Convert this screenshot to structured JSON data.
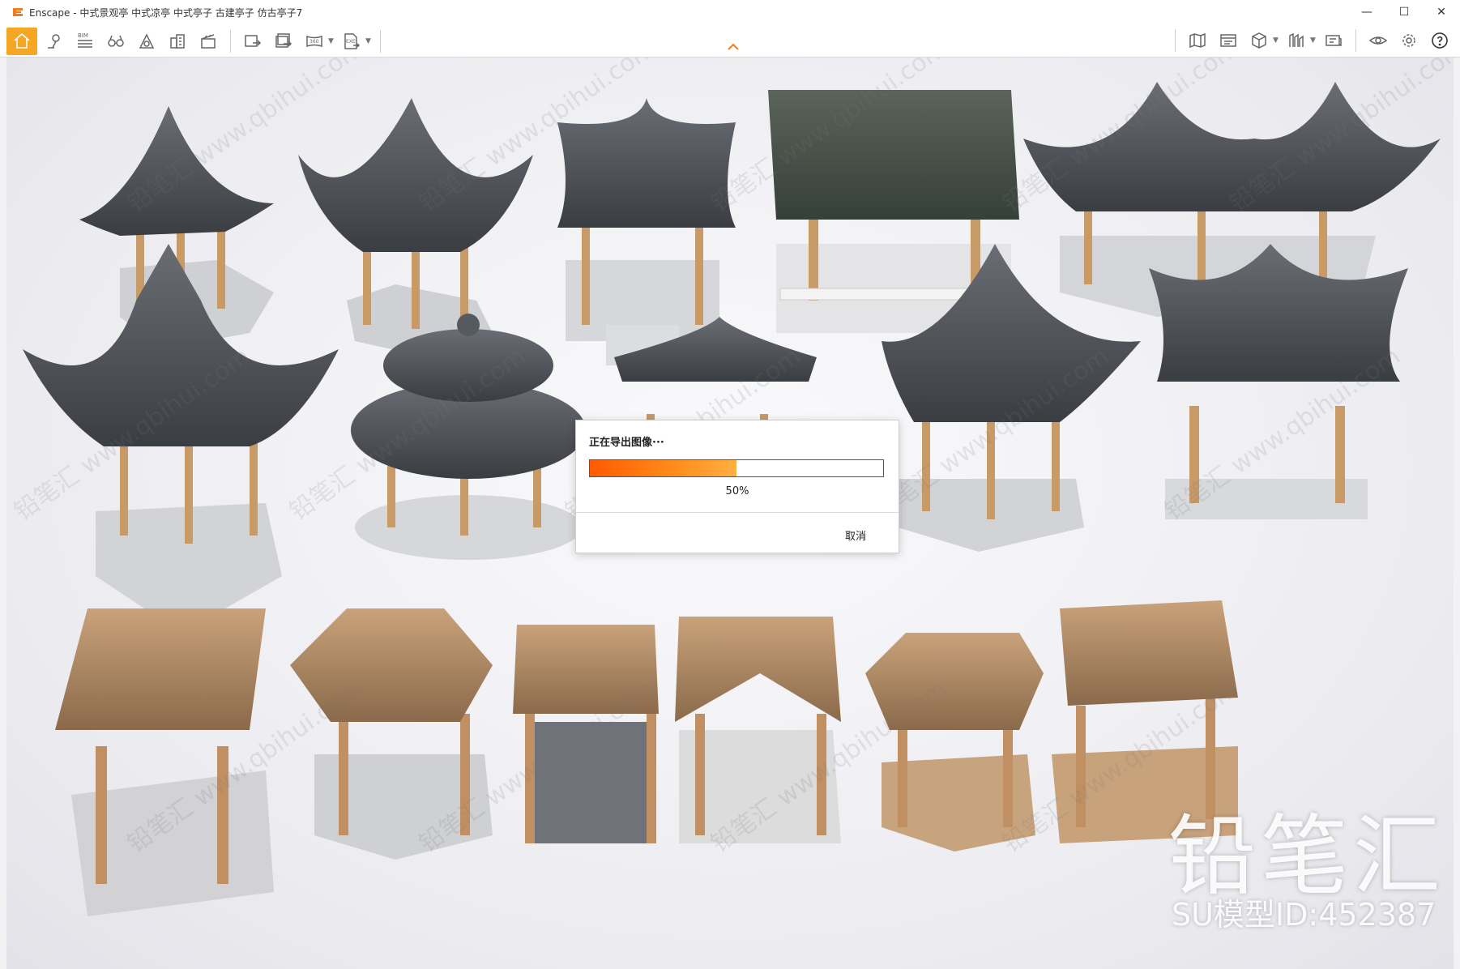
{
  "window": {
    "title": "Enscape - 中式景观亭 中式凉亭 中式亭子 古建亭子 仿古亭子7",
    "accent": "#f5a623",
    "controls": {
      "minimize": "—",
      "maximize": "☐",
      "close": "✕"
    }
  },
  "toolbar": {
    "left_groups": [
      [
        "home-icon",
        "map-pin-icon",
        "bim-icon",
        "binoculars-icon",
        "atmosphere-icon",
        "building-icon",
        "clapper-icon"
      ],
      [
        "screenshot-icon",
        "batch-render-icon",
        "panorama-360-icon",
        "export-exe-icon"
      ]
    ],
    "right_groups": [
      [
        "map-icon",
        "view-icon",
        "cube-icon",
        "asset-library-icon",
        "collaborate-icon"
      ],
      [
        "eye-icon",
        "settings-gear-icon",
        "help-icon"
      ]
    ],
    "bim_label": "BIM",
    "pano_label": "360",
    "exe_label": "EXE"
  },
  "viewport": {
    "watermark_brand": "铅笔汇",
    "watermark_id": "SU模型ID:452387",
    "watermark_tile": "铅笔汇 www.qbihui.com"
  },
  "dialog": {
    "title": "正在导出图像···",
    "progress_percent": 50,
    "progress_label": "50%",
    "cancel_label": "取消"
  }
}
